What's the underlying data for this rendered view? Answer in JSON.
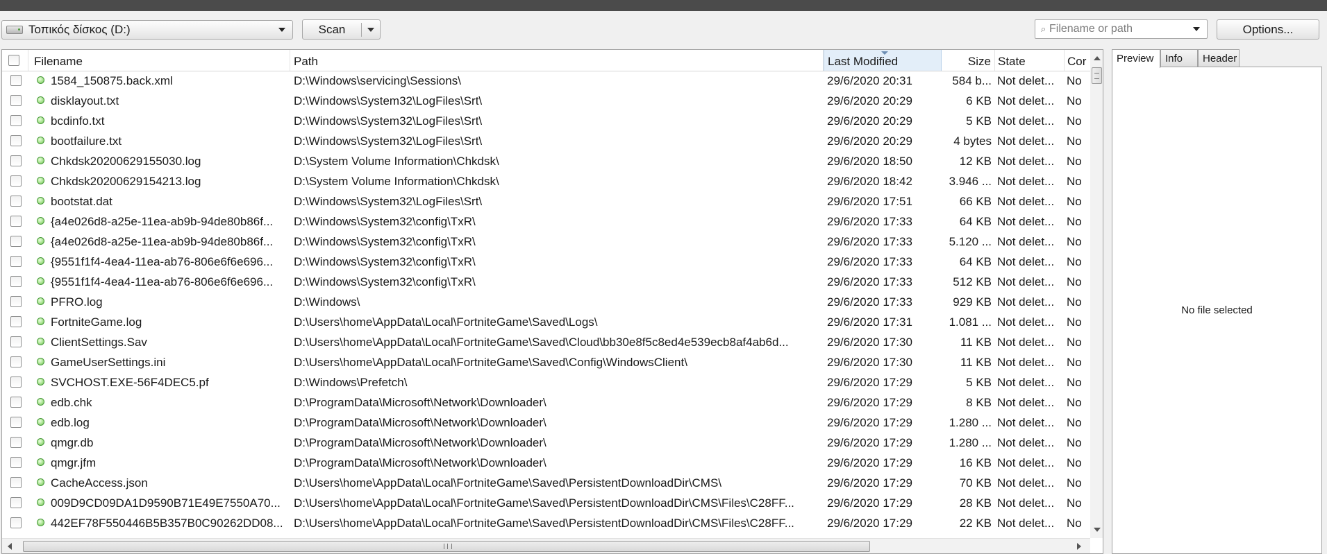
{
  "toolbar": {
    "drive_label": "Τοπικός δίσκος (D:)",
    "scan_label": "Scan",
    "search_placeholder": "Filename or path",
    "options_label": "Options..."
  },
  "columns": {
    "filename": "Filename",
    "path": "Path",
    "last_modified": "Last Modified",
    "size": "Size",
    "state": "State",
    "comment": "Cor"
  },
  "sorted_column": "Last Modified",
  "status_color": "#66b84f",
  "rows": [
    {
      "filename": "1584_150875.back.xml",
      "path": "D:\\Windows\\servicing\\Sessions\\",
      "modified": "29/6/2020 20:31",
      "size": "584 b...",
      "state": "Not delet...",
      "comment": "No"
    },
    {
      "filename": "disklayout.txt",
      "path": "D:\\Windows\\System32\\LogFiles\\Srt\\",
      "modified": "29/6/2020 20:29",
      "size": "6 KB",
      "state": "Not delet...",
      "comment": "No"
    },
    {
      "filename": "bcdinfo.txt",
      "path": "D:\\Windows\\System32\\LogFiles\\Srt\\",
      "modified": "29/6/2020 20:29",
      "size": "5 KB",
      "state": "Not delet...",
      "comment": "No"
    },
    {
      "filename": "bootfailure.txt",
      "path": "D:\\Windows\\System32\\LogFiles\\Srt\\",
      "modified": "29/6/2020 20:29",
      "size": "4 bytes",
      "state": "Not delet...",
      "comment": "No"
    },
    {
      "filename": "Chkdsk20200629155030.log",
      "path": "D:\\System Volume Information\\Chkdsk\\",
      "modified": "29/6/2020 18:50",
      "size": "12 KB",
      "state": "Not delet...",
      "comment": "No"
    },
    {
      "filename": "Chkdsk20200629154213.log",
      "path": "D:\\System Volume Information\\Chkdsk\\",
      "modified": "29/6/2020 18:42",
      "size": "3.946 ...",
      "state": "Not delet...",
      "comment": "No"
    },
    {
      "filename": "bootstat.dat",
      "path": "D:\\Windows\\System32\\LogFiles\\Srt\\",
      "modified": "29/6/2020 17:51",
      "size": "66 KB",
      "state": "Not delet...",
      "comment": "No"
    },
    {
      "filename": "{a4e026d8-a25e-11ea-ab9b-94de80b86f...",
      "path": "D:\\Windows\\System32\\config\\TxR\\",
      "modified": "29/6/2020 17:33",
      "size": "64 KB",
      "state": "Not delet...",
      "comment": "No"
    },
    {
      "filename": "{a4e026d8-a25e-11ea-ab9b-94de80b86f...",
      "path": "D:\\Windows\\System32\\config\\TxR\\",
      "modified": "29/6/2020 17:33",
      "size": "5.120 ...",
      "state": "Not delet...",
      "comment": "No"
    },
    {
      "filename": "{9551f1f4-4ea4-11ea-ab76-806e6f6e696...",
      "path": "D:\\Windows\\System32\\config\\TxR\\",
      "modified": "29/6/2020 17:33",
      "size": "64 KB",
      "state": "Not delet...",
      "comment": "No"
    },
    {
      "filename": "{9551f1f4-4ea4-11ea-ab76-806e6f6e696...",
      "path": "D:\\Windows\\System32\\config\\TxR\\",
      "modified": "29/6/2020 17:33",
      "size": "512 KB",
      "state": "Not delet...",
      "comment": "No"
    },
    {
      "filename": "PFRO.log",
      "path": "D:\\Windows\\",
      "modified": "29/6/2020 17:33",
      "size": "929 KB",
      "state": "Not delet...",
      "comment": "No"
    },
    {
      "filename": "FortniteGame.log",
      "path": "D:\\Users\\home\\AppData\\Local\\FortniteGame\\Saved\\Logs\\",
      "modified": "29/6/2020 17:31",
      "size": "1.081 ...",
      "state": "Not delet...",
      "comment": "No"
    },
    {
      "filename": "ClientSettings.Sav",
      "path": "D:\\Users\\home\\AppData\\Local\\FortniteGame\\Saved\\Cloud\\bb30e8f5c8ed4e539ecb8af4ab6d...",
      "modified": "29/6/2020 17:30",
      "size": "11 KB",
      "state": "Not delet...",
      "comment": "No"
    },
    {
      "filename": "GameUserSettings.ini",
      "path": "D:\\Users\\home\\AppData\\Local\\FortniteGame\\Saved\\Config\\WindowsClient\\",
      "modified": "29/6/2020 17:30",
      "size": "11 KB",
      "state": "Not delet...",
      "comment": "No"
    },
    {
      "filename": "SVCHOST.EXE-56F4DEC5.pf",
      "path": "D:\\Windows\\Prefetch\\",
      "modified": "29/6/2020 17:29",
      "size": "5 KB",
      "state": "Not delet...",
      "comment": "No"
    },
    {
      "filename": "edb.chk",
      "path": "D:\\ProgramData\\Microsoft\\Network\\Downloader\\",
      "modified": "29/6/2020 17:29",
      "size": "8 KB",
      "state": "Not delet...",
      "comment": "No"
    },
    {
      "filename": "edb.log",
      "path": "D:\\ProgramData\\Microsoft\\Network\\Downloader\\",
      "modified": "29/6/2020 17:29",
      "size": "1.280 ...",
      "state": "Not delet...",
      "comment": "No"
    },
    {
      "filename": "qmgr.db",
      "path": "D:\\ProgramData\\Microsoft\\Network\\Downloader\\",
      "modified": "29/6/2020 17:29",
      "size": "1.280 ...",
      "state": "Not delet...",
      "comment": "No"
    },
    {
      "filename": "qmgr.jfm",
      "path": "D:\\ProgramData\\Microsoft\\Network\\Downloader\\",
      "modified": "29/6/2020 17:29",
      "size": "16 KB",
      "state": "Not delet...",
      "comment": "No"
    },
    {
      "filename": "CacheAccess.json",
      "path": "D:\\Users\\home\\AppData\\Local\\FortniteGame\\Saved\\PersistentDownloadDir\\CMS\\",
      "modified": "29/6/2020 17:29",
      "size": "70 KB",
      "state": "Not delet...",
      "comment": "No"
    },
    {
      "filename": "009D9CD09DA1D9590B71E49E7550A70...",
      "path": "D:\\Users\\home\\AppData\\Local\\FortniteGame\\Saved\\PersistentDownloadDir\\CMS\\Files\\C28FF...",
      "modified": "29/6/2020 17:29",
      "size": "28 KB",
      "state": "Not delet...",
      "comment": "No"
    },
    {
      "filename": "442EF78F550446B5B357B0C90262DD08...",
      "path": "D:\\Users\\home\\AppData\\Local\\FortniteGame\\Saved\\PersistentDownloadDir\\CMS\\Files\\C28FF...",
      "modified": "29/6/2020 17:29",
      "size": "22 KB",
      "state": "Not delet...",
      "comment": "No"
    }
  ],
  "preview": {
    "tabs": [
      "Preview",
      "Info",
      "Header"
    ],
    "active_tab": "Preview",
    "empty_message": "No file selected"
  }
}
